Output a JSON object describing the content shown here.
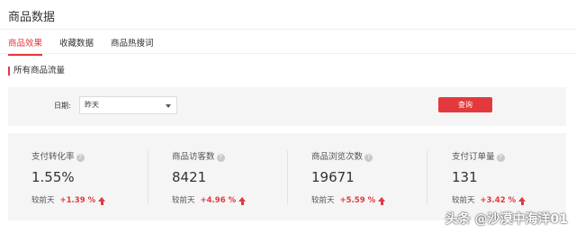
{
  "header": {
    "title": "商品数据"
  },
  "tabs": [
    {
      "label": "商品效果",
      "active": true
    },
    {
      "label": "收藏数据",
      "active": false
    },
    {
      "label": "商品热搜词",
      "active": false
    }
  ],
  "section": {
    "title": "所有商品流量"
  },
  "filter": {
    "date_label": "日期:",
    "date_value": "昨天",
    "query_label": "查询"
  },
  "stats": [
    {
      "label": "支付转化率",
      "value": "1.55%",
      "compare_label": "较前天",
      "change": "+1.39 %",
      "trend": "up"
    },
    {
      "label": "商品访客数",
      "value": "8421",
      "compare_label": "较前天",
      "change": "+4.96 %",
      "trend": "up"
    },
    {
      "label": "商品浏览次数",
      "value": "19671",
      "compare_label": "较前天",
      "change": "+5.59 %",
      "trend": "up"
    },
    {
      "label": "支付订单量",
      "value": "131",
      "compare_label": "较前天",
      "change": "+3.42 %",
      "trend": "up"
    }
  ],
  "watermark": "头条 @沙漠中海洋01",
  "colors": {
    "accent": "#e4393c",
    "panel_bg": "#f5f5f5"
  },
  "icons": {
    "help": "question-circle-icon",
    "trend_up": "arrow-up-icon",
    "dropdown": "chevron-down-icon"
  }
}
